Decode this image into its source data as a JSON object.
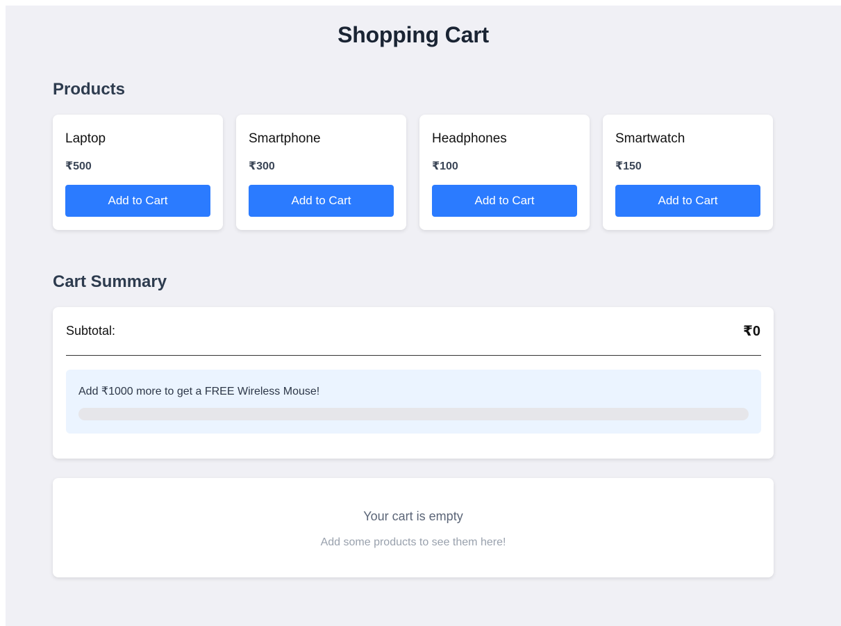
{
  "page": {
    "title": "Shopping Cart"
  },
  "products_section": {
    "title": "Products",
    "items": [
      {
        "name": "Laptop",
        "price": "₹500",
        "button_label": "Add to Cart"
      },
      {
        "name": "Smartphone",
        "price": "₹300",
        "button_label": "Add to Cart"
      },
      {
        "name": "Headphones",
        "price": "₹100",
        "button_label": "Add to Cart"
      },
      {
        "name": "Smartwatch",
        "price": "₹150",
        "button_label": "Add to Cart"
      }
    ]
  },
  "summary_section": {
    "title": "Cart Summary",
    "subtotal_label": "Subtotal:",
    "subtotal_value": "₹0",
    "promo_text": "Add ₹1000 more to get a FREE Wireless Mouse!",
    "progress_percent": 0
  },
  "empty_cart": {
    "title": "Your cart is empty",
    "subtitle": "Add some products to see them here!"
  },
  "colors": {
    "accent": "#2b7bff",
    "background": "#f0f0f5",
    "promo_background": "#ebf4ff"
  }
}
